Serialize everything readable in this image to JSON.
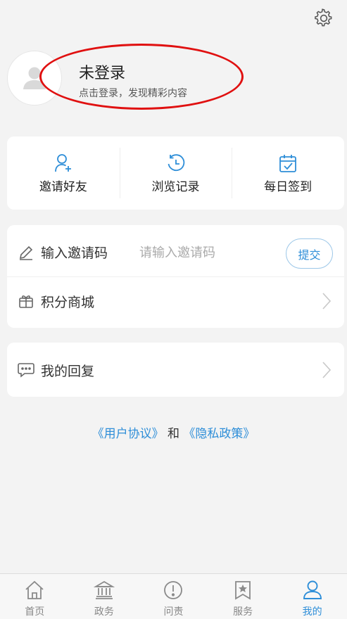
{
  "profile": {
    "title": "未登录",
    "subtitle": "点击登录，发现精彩内容"
  },
  "quick_actions": [
    {
      "label": "邀请好友",
      "icon": "add-friend-icon"
    },
    {
      "label": "浏览记录",
      "icon": "history-icon"
    },
    {
      "label": "每日签到",
      "icon": "calendar-check-icon"
    }
  ],
  "invite": {
    "label": "输入邀请码",
    "placeholder": "请输入邀请码",
    "submit_label": "提交",
    "icon": "pen-icon"
  },
  "points_mall": {
    "label": "积分商城",
    "icon": "gift-icon"
  },
  "my_replies": {
    "label": "我的回复",
    "icon": "comment-icon"
  },
  "agreements": {
    "user_agreement": "《用户协议》",
    "joiner": " 和 ",
    "privacy_policy": "《隐私政策》"
  },
  "tabbar": {
    "items": [
      {
        "label": "首页",
        "icon": "home-icon",
        "active": false
      },
      {
        "label": "政务",
        "icon": "government-building-icon",
        "active": false
      },
      {
        "label": "问责",
        "icon": "alert-circle-icon",
        "active": false
      },
      {
        "label": "服务",
        "icon": "service-star-icon",
        "active": false
      },
      {
        "label": "我的",
        "icon": "user-icon",
        "active": true
      }
    ]
  },
  "colors": {
    "accent": "#2e8ed8",
    "highlight_annotation": "#e01010",
    "background": "#f3f3f3"
  }
}
